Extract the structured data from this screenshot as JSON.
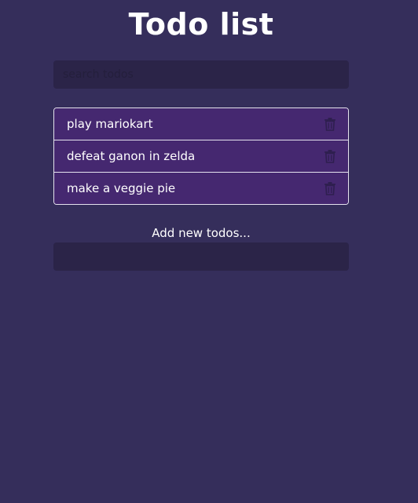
{
  "header": {
    "title": "Todo list"
  },
  "search": {
    "placeholder": "search todos",
    "value": ""
  },
  "todos": [
    {
      "text": "play mariokart",
      "icon": "trash-icon"
    },
    {
      "text": "defeat ganon in zelda",
      "icon": "trash-icon"
    },
    {
      "text": "make a veggie pie",
      "icon": "trash-icon"
    }
  ],
  "add": {
    "label": "Add new todos...",
    "value": ""
  },
  "colors": {
    "background": "#352e5b",
    "input_background": "#2b2448",
    "item_background": "#452870",
    "icon_color": "#2e1f4f"
  }
}
